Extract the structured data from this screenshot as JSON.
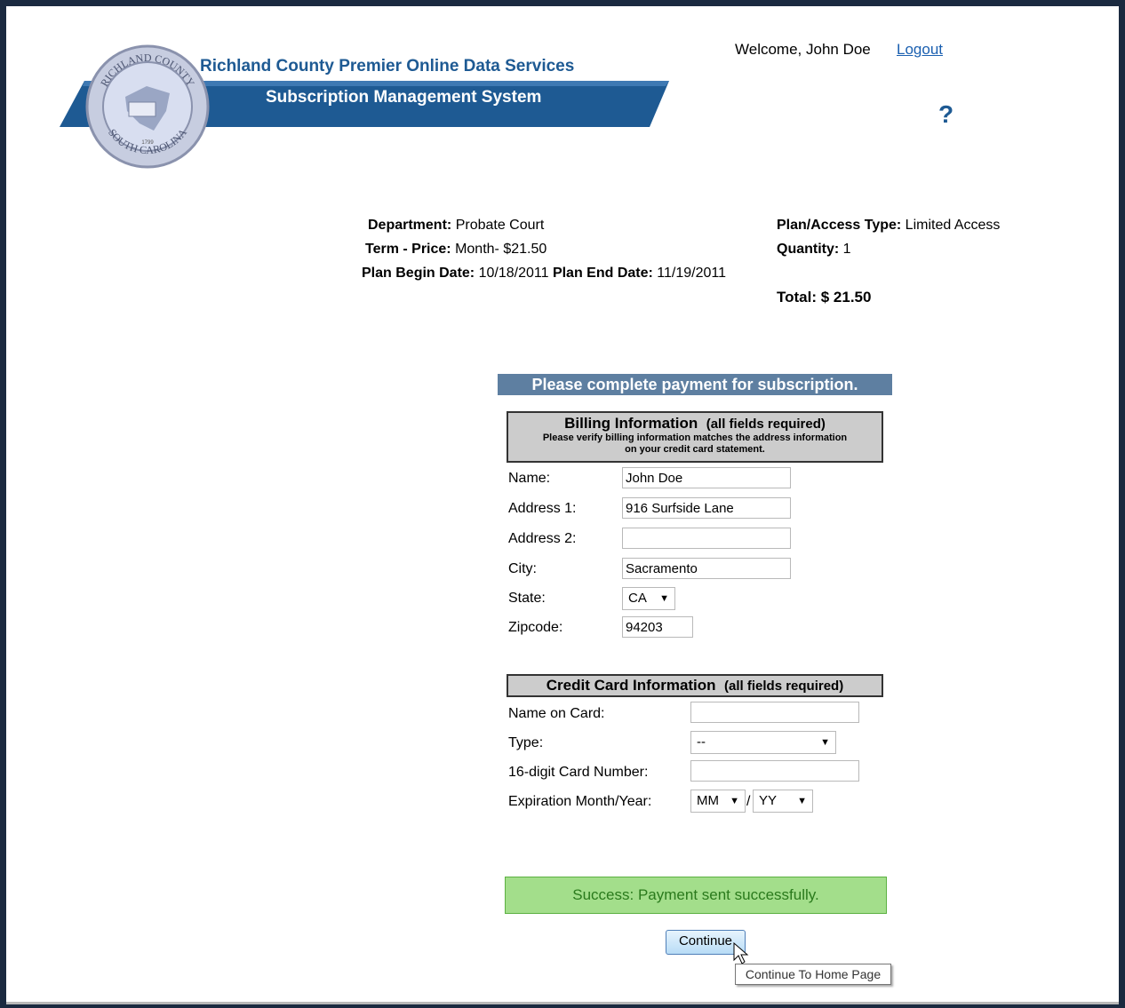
{
  "header": {
    "title": "Richland County Premier Online Data Services",
    "subtitle": "Subscription Management System",
    "seal": {
      "top": "RICHLAND COUNTY",
      "bottom": "SOUTH CAROLINA",
      "year": "1799"
    },
    "welcome": "Welcome, John Doe",
    "logout": "Logout",
    "help": "?"
  },
  "summary": {
    "department_label": "Department:",
    "department": "Probate Court",
    "term_label": "Term - Price:",
    "term": "Month- $21.50",
    "begin_label": "Plan Begin Date:",
    "begin": "10/18/2011",
    "end_label": "Plan End Date:",
    "end": "11/19/2011",
    "plan_label": "Plan/Access Type:",
    "plan": "Limited Access",
    "qty_label": "Quantity:",
    "qty": "1",
    "total_label": "Total:",
    "total": "$ 21.50"
  },
  "payment_banner": "Please complete payment for subscription.",
  "billing": {
    "heading": "Billing Information",
    "required": "(all fields required)",
    "note_line1": "Please verify billing information matches the address information",
    "note_line2": "on your credit card statement.",
    "fields": {
      "name_label": "Name:",
      "name": "John Doe",
      "addr1_label": "Address 1:",
      "addr1": "916 Surfside Lane",
      "addr2_label": "Address 2:",
      "addr2": "",
      "city_label": "City:",
      "city": "Sacramento",
      "state_label": "State:",
      "state": "CA",
      "zip_label": "Zipcode:",
      "zip": "94203"
    }
  },
  "credit_card": {
    "heading": "Credit Card Information",
    "required": "(all fields required)",
    "name_label": "Name on Card:",
    "name": "",
    "type_label": "Type:",
    "type": "--",
    "number_label": "16-digit Card Number:",
    "number": "",
    "exp_label": "Expiration Month/Year:",
    "month": "MM",
    "sep": "/",
    "year": "YY"
  },
  "status": "Success: Payment sent successfully.",
  "continue_button": "Continue",
  "tooltip": "Continue To Home Page"
}
